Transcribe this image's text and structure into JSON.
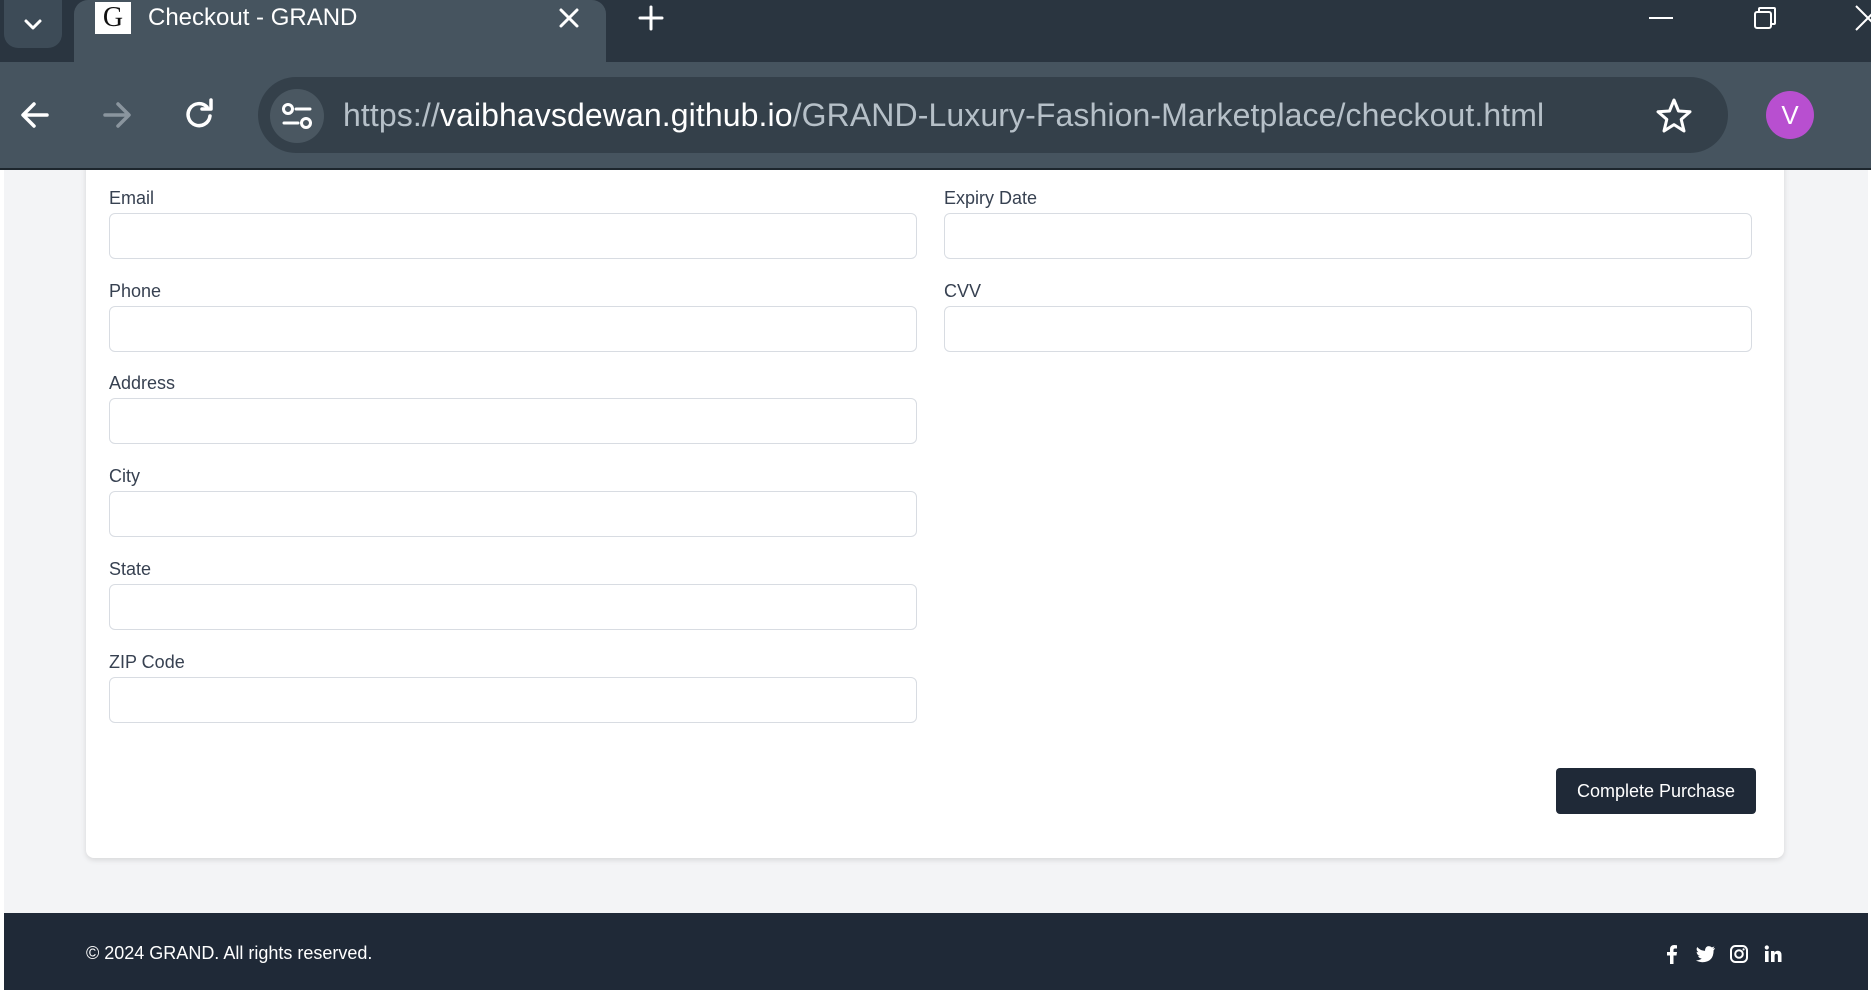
{
  "browser": {
    "tab_title": "Checkout - GRAND",
    "favicon_letter": "G",
    "url_scheme": "https://",
    "url_host": "vaibhavsdewan.github.io",
    "url_path": "/GRAND-Luxury-Fashion-Marketplace/checkout.html",
    "profile_initial": "V",
    "profile_color": "#b84fd0",
    "icons": [
      "tab-search-icon",
      "close-icon",
      "new-tab-icon",
      "minimize-icon",
      "restore-icon",
      "back-icon",
      "forward-icon",
      "reload-icon",
      "site-info-icon",
      "bookmark-star-icon"
    ]
  },
  "form": {
    "left_fields": [
      {
        "label": "Email",
        "value": ""
      },
      {
        "label": "Phone",
        "value": ""
      },
      {
        "label": "Address",
        "value": ""
      },
      {
        "label": "City",
        "value": ""
      },
      {
        "label": "State",
        "value": ""
      },
      {
        "label": "ZIP Code",
        "value": ""
      }
    ],
    "right_fields": [
      {
        "label": "Expiry Date",
        "value": ""
      },
      {
        "label": "CVV",
        "value": ""
      }
    ],
    "submit_label": "Complete Purchase"
  },
  "footer": {
    "copyright": "© 2024 GRAND. All rights reserved.",
    "social_icons": [
      "facebook-icon",
      "twitter-icon",
      "instagram-icon",
      "linkedin-icon"
    ]
  },
  "colors": {
    "primary_button": "#1f2937",
    "page_background": "#f3f4f6",
    "footer_background": "#1f2937"
  }
}
